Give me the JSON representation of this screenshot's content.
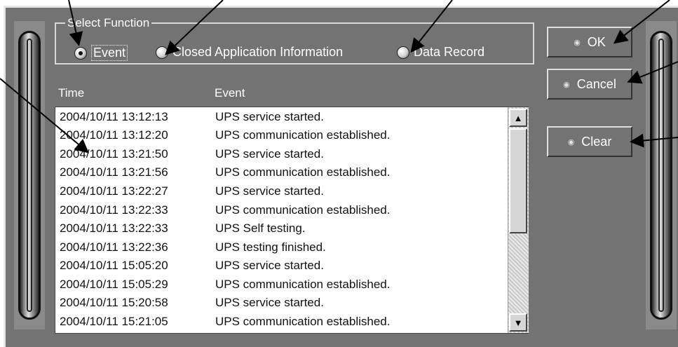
{
  "group": {
    "legend": "Select Function"
  },
  "radios": [
    {
      "label": "Event",
      "checked": true
    },
    {
      "label": "Closed Application Information",
      "checked": false
    },
    {
      "label": "Data Record",
      "checked": false
    }
  ],
  "columns": {
    "time": "Time",
    "event": "Event"
  },
  "rows": [
    {
      "time": "2004/10/11 13:12:13",
      "event": "UPS service started."
    },
    {
      "time": "2004/10/11 13:12:20",
      "event": "UPS communication established."
    },
    {
      "time": "2004/10/11 13:21:50",
      "event": "UPS service started."
    },
    {
      "time": "2004/10/11 13:21:56",
      "event": "UPS communication established."
    },
    {
      "time": "2004/10/11 13:22:27",
      "event": "UPS service started."
    },
    {
      "time": "2004/10/11 13:22:33",
      "event": "UPS communication established."
    },
    {
      "time": "2004/10/11 13:22:33",
      "event": "UPS Self testing."
    },
    {
      "time": "2004/10/11 13:22:36",
      "event": "UPS testing finished."
    },
    {
      "time": "2004/10/11 15:05:20",
      "event": "UPS service started."
    },
    {
      "time": "2004/10/11 15:05:29",
      "event": "UPS communication established."
    },
    {
      "time": "2004/10/11 15:20:58",
      "event": "UPS service started."
    },
    {
      "time": "2004/10/11 15:21:05",
      "event": "UPS communication established."
    }
  ],
  "buttons": {
    "ok": "OK",
    "cancel": "Cancel",
    "clear": "Clear"
  },
  "icons": {
    "radio": "radio-button-icon",
    "button": "button-bullet-icon",
    "scroll_up": "arrow-up-icon",
    "scroll_down": "arrow-down-icon"
  },
  "colors": {
    "panel": "#737373",
    "list_bg": "#ffffff",
    "text_light": "#ffffff",
    "text_dark": "#111111"
  }
}
